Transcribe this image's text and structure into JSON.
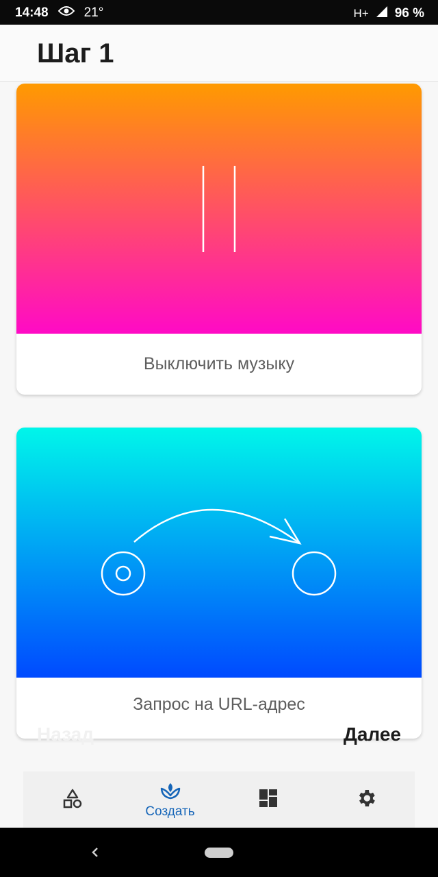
{
  "status_bar": {
    "time": "14:48",
    "temperature": "21°",
    "network": "H+",
    "battery": "96 %"
  },
  "app_bar": {
    "title": "Шаг 1"
  },
  "cards": [
    {
      "label": "Выключить музыку",
      "gradient": [
        "#ff9a00",
        "#ff0ac6"
      ],
      "icon": "pause-icon"
    },
    {
      "label": "Запрос на URL-адрес",
      "gradient": [
        "#00f6ea",
        "#004aff"
      ],
      "icon": "url-request-icon"
    }
  ],
  "nav_buttons": {
    "back": "Назад",
    "next": "Далее"
  },
  "bottom_nav": {
    "items": [
      {
        "icon": "shapes-icon",
        "label": ""
      },
      {
        "icon": "create-icon",
        "label": "Создать",
        "active": true
      },
      {
        "icon": "dashboard-icon",
        "label": ""
      },
      {
        "icon": "settings-icon",
        "label": ""
      }
    ],
    "active_color": "#1565b8"
  }
}
